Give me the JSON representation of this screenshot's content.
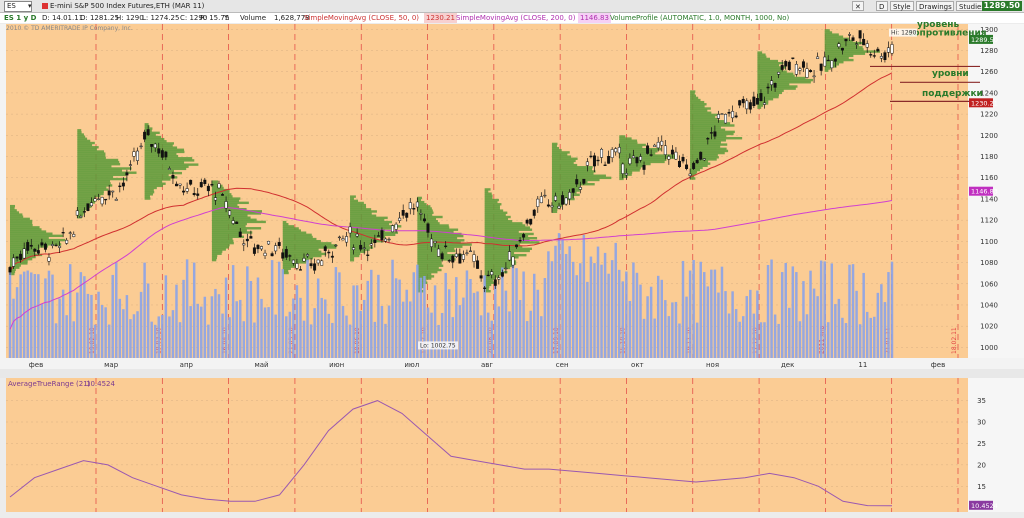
{
  "header": {
    "symbol": "ES",
    "title": "E-mini S&P 500 Index Futures,ETH (MAR 11)",
    "toolbar": {
      "d": "D",
      "style": "Style",
      "drawings": "Drawings",
      "studies": "Studies"
    },
    "last_price": "1289.50",
    "copyright": "2010 © TD AMERITRADE IP Company, Inc."
  },
  "info": {
    "interval": "ES 1 y D",
    "date": "D: 14.01.11",
    "open": "O: 1281.25",
    "high": "H: 1290",
    "low": "L: 1274.25",
    "close": "C: 1290",
    "range": "R: 15.75",
    "y": "Y:",
    "vol_name": "Volume",
    "vol_value": "1,628,778",
    "sma50_name": "SimpleMovingAvg (CLOSE, 50, 0)",
    "sma50_value": "1230.21",
    "sma200_name": "SimpleMovingAvg (CLOSE, 200, 0)",
    "sma200_value": "1146.83",
    "vp_name": "VolumeProfile (AUTOMATIC, 1.0, MONTH, 1000, No)"
  },
  "colors": {
    "background": "#fbcc94",
    "candle_up": "#1a1a1a",
    "profile": "#5a9a3a",
    "volume": "#8aa3e8",
    "sma50": "#d03030",
    "sma200": "#d040d0",
    "atr": "#9a58b0",
    "grid": "#e04040"
  },
  "annotations": {
    "resistance1": "уровень",
    "resistance2": "сопротивления",
    "support_line1": "уровни",
    "support_line2": "поддержки",
    "hi_label": "Hi: 1290",
    "lo_label": "Lo: 1002.75"
  },
  "chart_data": [
    {
      "type": "candlestick",
      "series": [
        {
          "name": "E-mini S&P 500 Index Futures,ETH (MAR 11)"
        },
        {
          "name": "SimpleMovingAvg (CLOSE, 50, 0)",
          "last": 1230.21
        },
        {
          "name": "SimpleMovingAvg (CLOSE, 200, 0)",
          "last": 1146.83
        },
        {
          "name": "Volume",
          "last": 1628778
        }
      ],
      "x_ticks": [
        "фев",
        "мар",
        "апр",
        "май",
        "июн",
        "июл",
        "авг",
        "сен",
        "окт",
        "ноя",
        "дек",
        "11",
        "фев"
      ],
      "expiry_labels": [
        "19.02.10",
        "19.03.10",
        "16.04.10",
        "21.05.10",
        "18.06.10",
        "16.07.10",
        "20.08.10",
        "17.09.10",
        "15.10.10",
        "19.11.10",
        "17.12.10",
        "2011 янв",
        "21.01.11",
        "18.02.11"
      ],
      "year_label": "2011",
      "y_ticks": [
        1000,
        1020,
        1040,
        1060,
        1080,
        1100,
        1120,
        1140,
        1160,
        1180,
        1200,
        1220,
        1240,
        1260,
        1280,
        1300
      ],
      "ylim": [
        990,
        1305
      ],
      "hi": 1290,
      "lo": 1002.75,
      "price_tags": {
        "close": "1289.50",
        "sma50": "1230.21",
        "sma200": "1146.83"
      },
      "monthly_closes": [
        1075,
        1115,
        1190,
        1140,
        1080,
        1095,
        1125,
        1060,
        1140,
        1183,
        1175,
        1240,
        1276,
        1290
      ]
    },
    {
      "type": "line",
      "title": "AverageTrueRange (21)",
      "value_label": "10.4524",
      "last_tag": "10.4524",
      "y_ticks": [
        15,
        20,
        25,
        30,
        35
      ],
      "ylim": [
        9,
        37
      ],
      "points": [
        12.5,
        17,
        19,
        21,
        20,
        17,
        15,
        13,
        12,
        11.5,
        11.5,
        13,
        20,
        28,
        33,
        35,
        32,
        27,
        22,
        21,
        20,
        19,
        19,
        18.5,
        18,
        17.5,
        17,
        16.5,
        16,
        16.5,
        17,
        18,
        17,
        15,
        11.5,
        10.5,
        10.45
      ]
    }
  ]
}
